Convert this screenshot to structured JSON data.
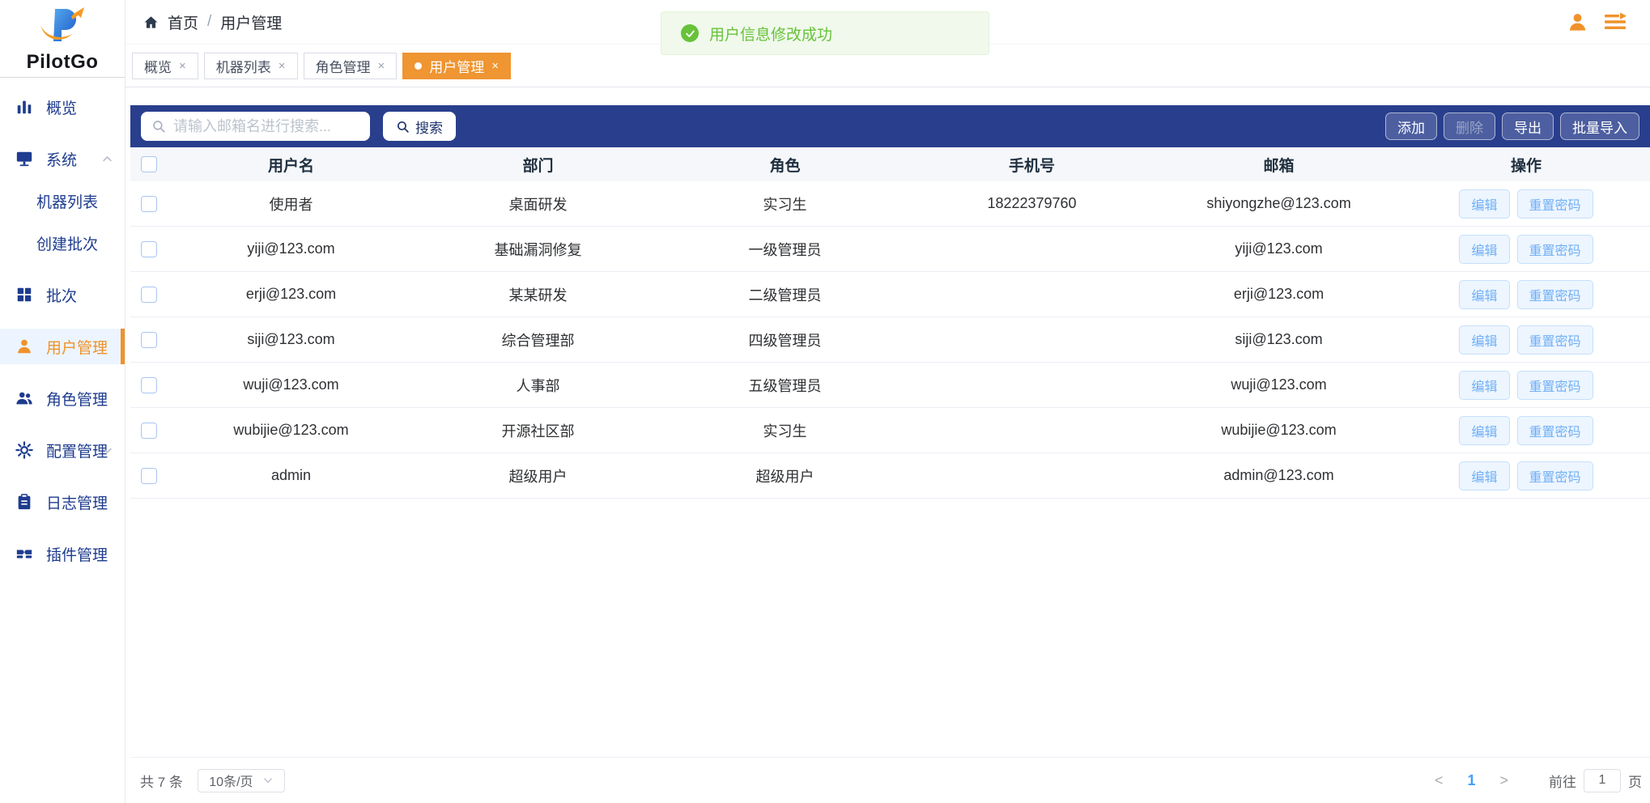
{
  "brand": {
    "name": "PilotGo"
  },
  "colors": {
    "accent_orange": "#f0922b",
    "toolbar_navy": "#293f8d",
    "primary_blue": "#409eff",
    "success_green": "#67c23a",
    "active_item_bg": "#ecf5ff"
  },
  "header": {
    "breadcrumb": [
      {
        "label": "首页"
      },
      {
        "label": "用户管理"
      }
    ],
    "separator": "/"
  },
  "toast": {
    "message": "用户信息修改成功"
  },
  "tabs": [
    {
      "label": "概览",
      "close": "×",
      "active": false
    },
    {
      "label": "机器列表",
      "close": "×",
      "active": false
    },
    {
      "label": "角色管理",
      "close": "×",
      "active": false
    },
    {
      "label": "用户管理",
      "close": "×",
      "active": true
    }
  ],
  "sidebar": {
    "items": [
      {
        "label": "概览",
        "icon": "bar-chart-icon"
      },
      {
        "label": "系统",
        "icon": "monitor-icon",
        "expanded": true,
        "children": [
          {
            "label": "机器列表"
          },
          {
            "label": "创建批次"
          }
        ]
      },
      {
        "label": "批次",
        "icon": "grid-icon"
      },
      {
        "label": "用户管理",
        "icon": "user-icon",
        "active": true
      },
      {
        "label": "角色管理",
        "icon": "users-icon"
      },
      {
        "label": "配置管理",
        "icon": "gear-icon",
        "expanded": false
      },
      {
        "label": "日志管理",
        "icon": "clipboard-icon"
      },
      {
        "label": "插件管理",
        "icon": "plugin-icon"
      }
    ]
  },
  "toolbar": {
    "search_placeholder": "请输入邮箱名进行搜索...",
    "search_button": "搜索",
    "actions": [
      {
        "label": "添加",
        "disabled": false
      },
      {
        "label": "删除",
        "disabled": true
      },
      {
        "label": "导出",
        "disabled": false
      },
      {
        "label": "批量导入",
        "disabled": false
      }
    ]
  },
  "table": {
    "columns": [
      "用户名",
      "部门",
      "角色",
      "手机号",
      "邮箱",
      "操作"
    ],
    "edit_label": "编辑",
    "reset_label": "重置密码",
    "rows": [
      {
        "username": "使用者",
        "department": "桌面研发",
        "role": "实习生",
        "phone": "18222379760",
        "email": "shiyongzhe@123.com"
      },
      {
        "username": "yiji@123.com",
        "department": "基础漏洞修复",
        "role": "一级管理员",
        "phone": "",
        "email": "yiji@123.com"
      },
      {
        "username": "erji@123.com",
        "department": "某某研发",
        "role": "二级管理员",
        "phone": "",
        "email": "erji@123.com"
      },
      {
        "username": "siji@123.com",
        "department": "综合管理部",
        "role": "四级管理员",
        "phone": "",
        "email": "siji@123.com"
      },
      {
        "username": "wuji@123.com",
        "department": "人事部",
        "role": "五级管理员",
        "phone": "",
        "email": "wuji@123.com"
      },
      {
        "username": "wubijie@123.com",
        "department": "开源社区部",
        "role": "实习生",
        "phone": "",
        "email": "wubijie@123.com"
      },
      {
        "username": "admin",
        "department": "超级用户",
        "role": "超级用户",
        "phone": "",
        "email": "admin@123.com"
      }
    ]
  },
  "pagination": {
    "total": "共 7 条",
    "page_size": "10条/页",
    "prev": "<",
    "current_page": "1",
    "next": ">",
    "goto_label": "前往",
    "goto_value": "1",
    "page_suffix": "页"
  }
}
